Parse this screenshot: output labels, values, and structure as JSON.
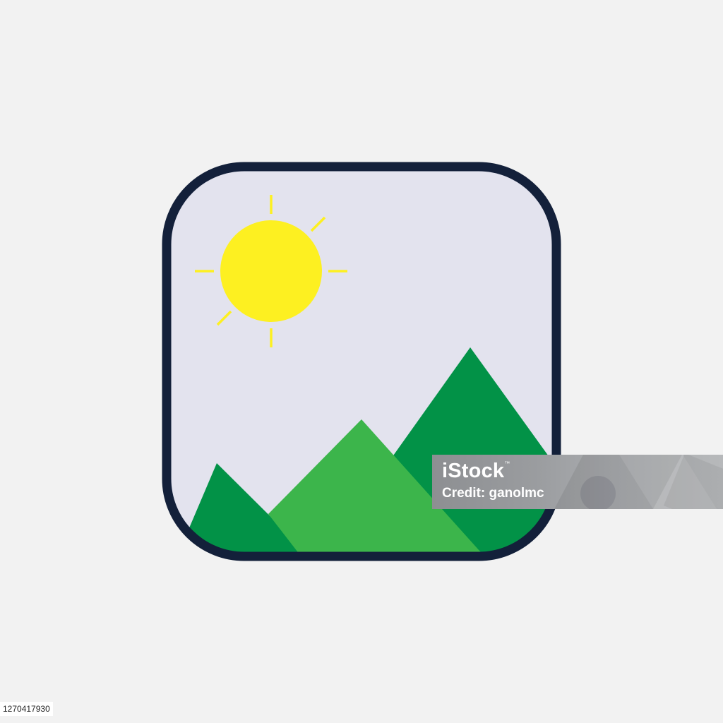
{
  "illustration": {
    "subject": "image-placeholder-icon",
    "colors": {
      "background": "#f2f2f2",
      "frame_stroke": "#13203a",
      "frame_fill": "#e3e3ee",
      "sun": "#fdf021",
      "mountain_dark": "#029247",
      "mountain_light": "#3cb54b"
    },
    "icons": [
      "sun-icon",
      "mountain-icon"
    ]
  },
  "watermark": {
    "brand": "iStock",
    "trademark": "™",
    "credit": "Credit: ganolmc"
  },
  "image_id": "1270417930"
}
